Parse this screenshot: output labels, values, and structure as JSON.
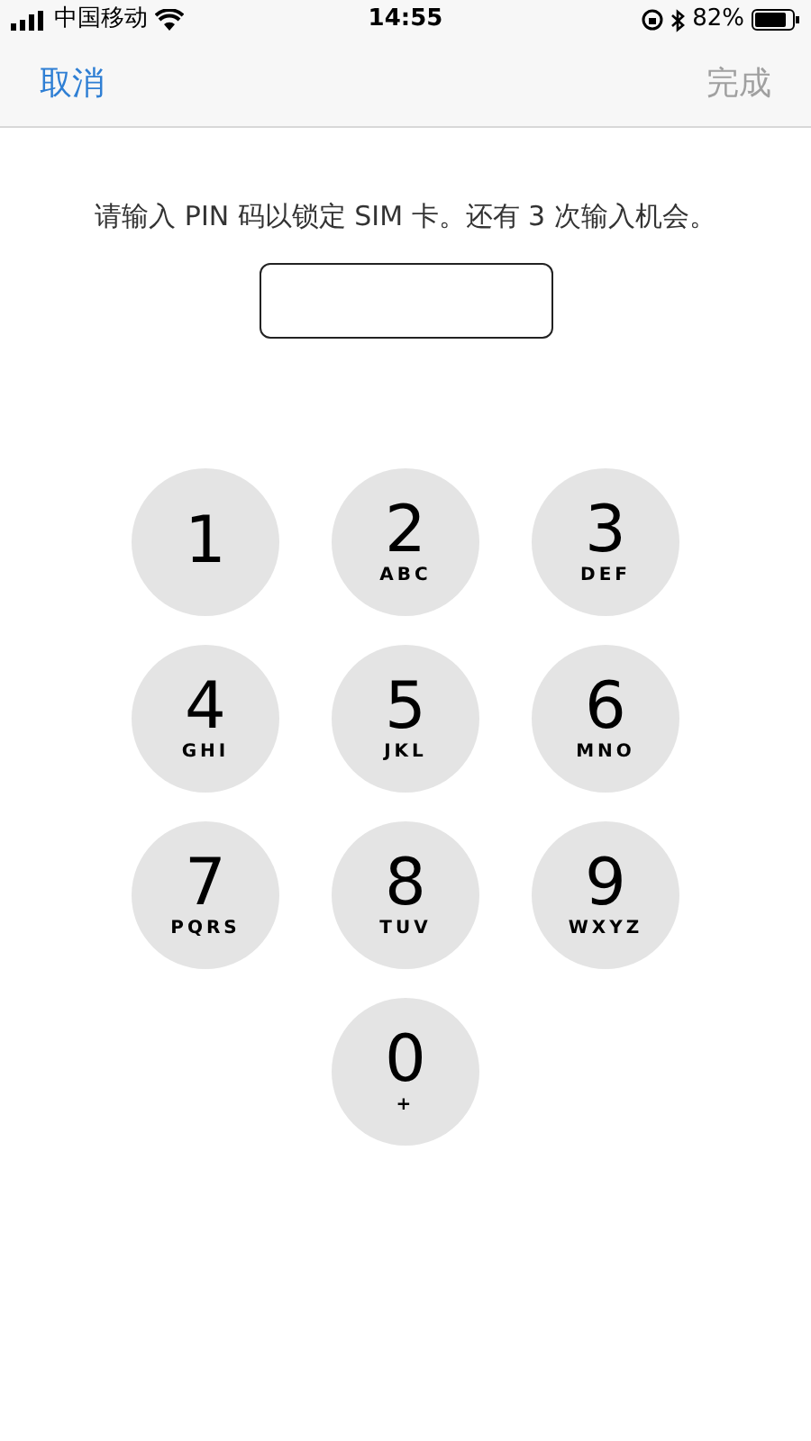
{
  "status_bar": {
    "carrier": "中国移动",
    "time": "14:55",
    "battery": "82%"
  },
  "nav": {
    "cancel": "取消",
    "done": {
      "label": "完成",
      "disabled": true
    }
  },
  "prompt": "请输入 PIN 码以锁定 SIM 卡。还有 3 次输入机会。",
  "keys": [
    {
      "digit": "1"
    },
    {
      "digit": "2",
      "letters": "ABC"
    },
    {
      "digit": "3",
      "letters": "DEF"
    },
    {
      "digit": "4",
      "letters": "GHI"
    },
    {
      "digit": "5",
      "letters": "JKL"
    },
    {
      "digit": "6",
      "letters": "MNO"
    },
    {
      "digit": "7",
      "letters": "PQRS"
    },
    {
      "digit": "8",
      "letters": "TUV"
    },
    {
      "digit": "9",
      "letters": "WXYZ"
    },
    {
      "digit": "0",
      "letters": "+"
    }
  ]
}
